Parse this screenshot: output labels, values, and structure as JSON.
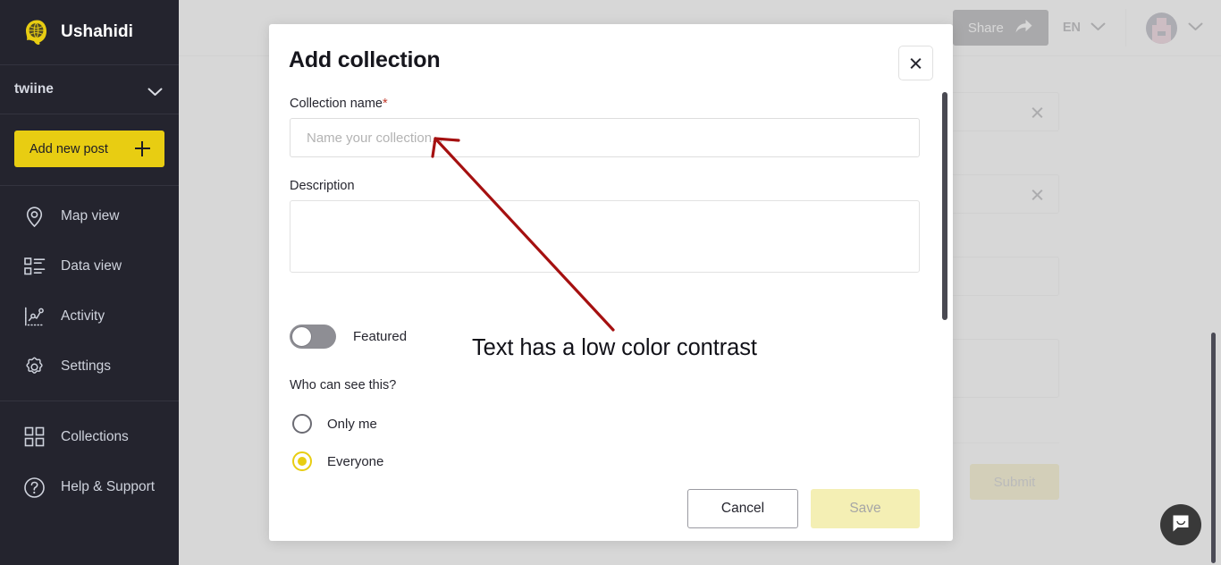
{
  "sidebar": {
    "brand": {
      "name": "Ushahidi",
      "logo_icon": "ushahidi-globe-logo"
    },
    "workspace": {
      "name": "twiine",
      "chevron_icon": "chevron-down-icon"
    },
    "add_post": {
      "label": "Add new post",
      "icon": "plus-icon"
    },
    "primary_items": [
      {
        "label": "Map view",
        "icon": "map-pin-icon"
      },
      {
        "label": "Data view",
        "icon": "list-view-icon"
      },
      {
        "label": "Activity",
        "icon": "activity-chart-icon"
      },
      {
        "label": "Settings",
        "icon": "gear-icon"
      }
    ],
    "secondary_items": [
      {
        "label": "Collections",
        "icon": "grid-squares-icon"
      },
      {
        "label": "Help & Support",
        "icon": "question-circle-icon"
      }
    ]
  },
  "topbar": {
    "share": {
      "label": "Share",
      "icon": "share-arrow-icon"
    },
    "language": {
      "label": "EN",
      "chevron_icon": "chevron-down-icon"
    },
    "user": {
      "avatar_icon": "user-avatar",
      "chevron_icon": "chevron-down-icon"
    }
  },
  "background_page": {
    "clear_icon": "close-x-icon",
    "submit_label": "Submit"
  },
  "modal": {
    "title": "Add collection",
    "close_icon": "close-x-icon",
    "collection_name": {
      "label": "Collection name",
      "required_marker": "*",
      "placeholder": "Name your collection...",
      "value": ""
    },
    "description": {
      "label": "Description",
      "placeholder": "",
      "value": ""
    },
    "featured": {
      "label": "Featured",
      "checked": false
    },
    "visibility": {
      "label": "Who can see this?",
      "options": [
        {
          "label": "Only me",
          "selected": false
        },
        {
          "label": "Everyone",
          "selected": true
        }
      ]
    },
    "footer": {
      "cancel_label": "Cancel",
      "save_label": "Save",
      "save_disabled": true
    }
  },
  "annotation": {
    "text": "Text has a low color contrast",
    "arrow_color": "#a51010"
  },
  "chat": {
    "icon": "chat-bubble-icon"
  },
  "colors": {
    "brand_yellow": "#e8cd12",
    "sidebar_bg": "#24242e",
    "overlay": "#cdcdcd",
    "annotation_red": "#a51010",
    "required_red": "#c0392b"
  }
}
